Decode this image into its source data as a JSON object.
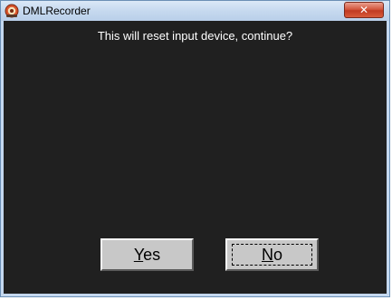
{
  "window": {
    "title": "DMLRecorder",
    "app_icon": "recorder-app-icon",
    "close_glyph": "✕",
    "close_icon": "close-icon"
  },
  "dialog": {
    "message": "This will reset input device, continue?",
    "yes_button": {
      "mnemonic": "Y",
      "rest": "es"
    },
    "no_button": {
      "mnemonic": "N",
      "rest": "o",
      "focused": true
    }
  },
  "colors": {
    "client_background": "#202020",
    "message_text": "#ffffff",
    "button_face": "#c8c8c8",
    "close_button": "#c13a22"
  }
}
